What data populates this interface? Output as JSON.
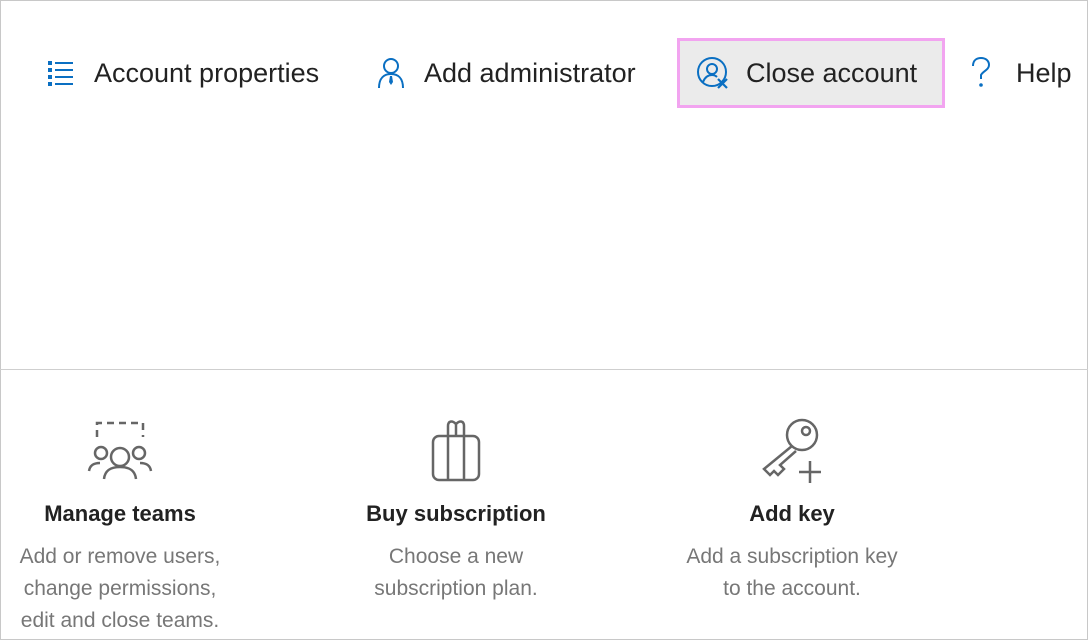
{
  "toolbar": {
    "items": [
      {
        "label": "Account properties",
        "icon": "list-icon"
      },
      {
        "label": "Add administrator",
        "icon": "person-tie-icon"
      },
      {
        "label": "Close account",
        "icon": "person-remove-icon"
      },
      {
        "label": "Help",
        "icon": "question-mark-icon"
      }
    ],
    "accent_color": "#0a6fc2",
    "highlight_border_color": "#f2a4f0"
  },
  "cards": [
    {
      "title": "Manage teams",
      "desc_lines": [
        "Add or remove users,",
        "change permissions,",
        "edit and close teams."
      ],
      "icon": "team-icon"
    },
    {
      "title": "Buy subscription",
      "desc_lines": [
        "Choose a new",
        "subscription plan."
      ],
      "icon": "gift-bag-icon"
    },
    {
      "title": "Add key",
      "desc_lines": [
        "Add a subscription key",
        "to the account."
      ],
      "icon": "key-add-icon"
    }
  ]
}
